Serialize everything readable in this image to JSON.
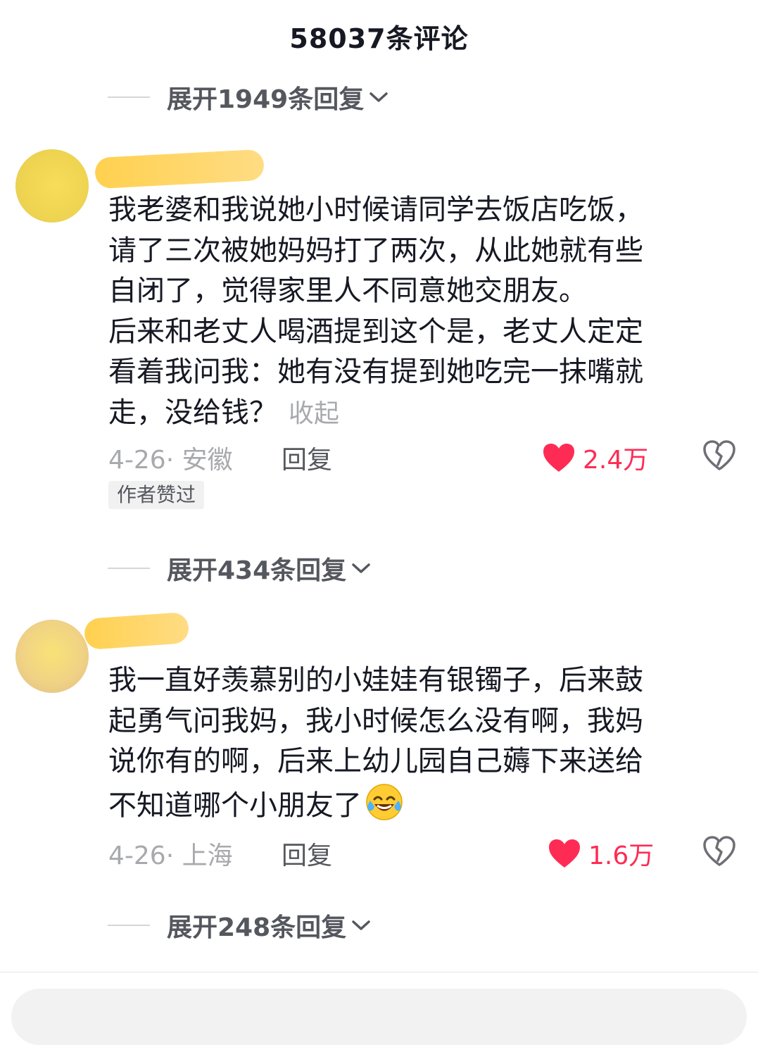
{
  "header": {
    "title": "58037条评论"
  },
  "expand_top": {
    "label": "展开1949条回复"
  },
  "comments": [
    {
      "text": "我老婆和我说她小时候请同学去饭店吃饭，\n请了三次被她妈妈打了两次，从此她就有些\n自闭了，觉得家里人不同意她交朋友。\n后来和老丈人喝酒提到这个是，老丈人定定\n看着我问我：她有没有提到她吃完一抹嘴就\n走，没给钱？",
      "collapse_label": "收起",
      "meta": "4-26· 安徽",
      "reply_label": "回复",
      "likes": "2.4万",
      "badge": "作者赞过",
      "expand_label": "展开434条回复"
    },
    {
      "text": "我一直好羡慕别的小娃娃有银镯子，后来鼓\n起勇气问我妈，我小时候怎么没有啊，我妈\n说你有的啊，后来上幼儿园自己薅下来送给\n不知道哪个小朋友了",
      "emoji": "laugh-cry-emoji",
      "meta": "4-26· 上海",
      "reply_label": "回复",
      "likes": "1.6万",
      "expand_label": "展开248条回复"
    }
  ],
  "colors": {
    "like": "#fe2c55",
    "text": "#161823",
    "secondary": "#a8a9ad",
    "highlight": "#ffce46"
  }
}
